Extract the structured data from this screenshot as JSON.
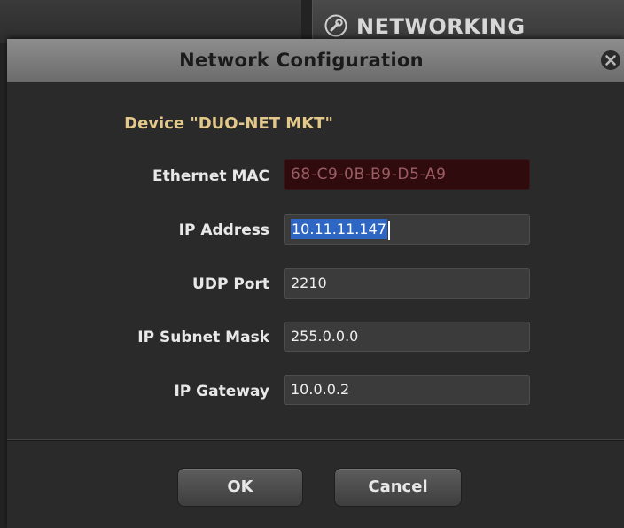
{
  "background": {
    "tab_label": "NETWORKING",
    "tab_icon": "wrench-icon"
  },
  "dialog": {
    "title": "Network Configuration",
    "close_icon": "close-icon",
    "device_label": "Device \"DUO-NET MKT\"",
    "fields": {
      "mac": {
        "label": "Ethernet MAC",
        "value": "68-C9-0B-B9-D5-A9"
      },
      "ip": {
        "label": "IP Address",
        "value": "10.11.11.147"
      },
      "udp": {
        "label": "UDP Port",
        "value": "2210"
      },
      "subnet": {
        "label": "IP Subnet Mask",
        "value": "255.0.0.0"
      },
      "gateway": {
        "label": "IP Gateway",
        "value": "10.0.0.2"
      }
    },
    "buttons": {
      "ok": "OK",
      "cancel": "Cancel"
    }
  },
  "colors": {
    "device_label": "#e2c98b",
    "mac_field_bg": "#2f0b0e",
    "mac_text": "#9a5d62",
    "selection": "#2e66c4"
  }
}
